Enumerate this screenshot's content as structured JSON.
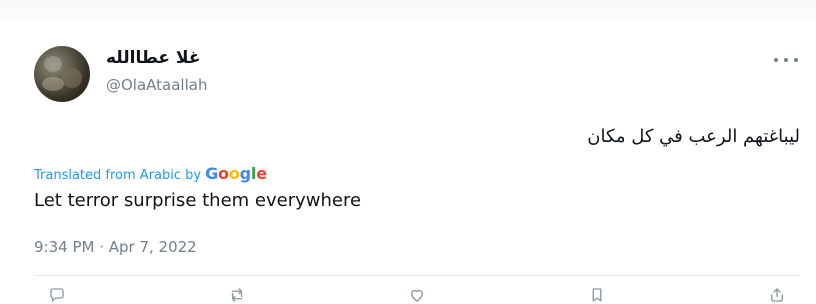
{
  "tweet": {
    "author": {
      "display_name": "غلا عطاالله",
      "handle": "@OlaAtaallah"
    },
    "text": "ليباغتهم الرعب في كل مكان",
    "translation_label": "Translated from Arabic by",
    "translation_provider": "Google",
    "translated_text": "Let terror surprise them everywhere",
    "timestamp": "9:34 PM · Apr 7, 2022"
  },
  "icons": {
    "more": "more-options-icon",
    "actions": [
      "reply-icon",
      "retweet-icon",
      "like-icon",
      "bookmark-icon",
      "share-icon"
    ]
  },
  "colors": {
    "link": "#1d9bf0",
    "muted": "#72808b",
    "divider": "#e9eef2",
    "text": "#0f1419"
  }
}
